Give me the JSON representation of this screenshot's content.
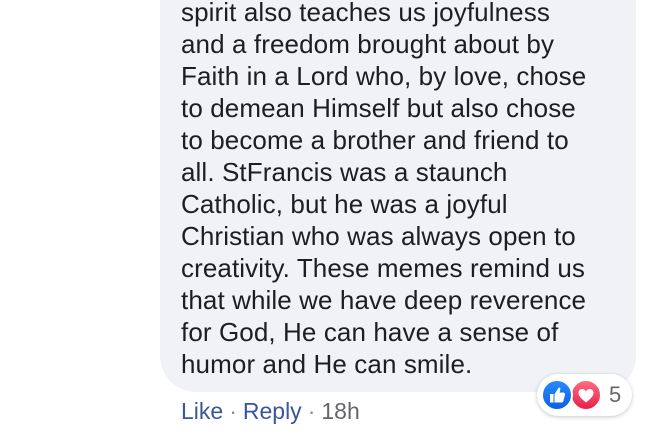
{
  "comment": {
    "lines": [
      "spirit also teaches us joyfulness",
      "and a freedom brought about by",
      "Faith in a Lord who, by love, chose",
      "to demean Himself but also chose",
      "to become a brother and friend to",
      "all. StFrancis was a staunch",
      "Catholic, but he was a joyful",
      "Christian who was always open to",
      "creativity. These memes remind us",
      "that while we have deep reverence",
      "for God, He can have a sense of",
      "humor and He can smile."
    ]
  },
  "actions": {
    "like_label": "Like",
    "reply_label": "Reply",
    "separator": "·",
    "timestamp": "18h"
  },
  "reactions": {
    "icons": [
      "like-icon",
      "love-icon"
    ],
    "count": "5",
    "colors": {
      "like": "#1877f2",
      "love": "#f33e58"
    }
  },
  "colors": {
    "bubble_background": "#f0f2f5",
    "text": "#1c1e21",
    "link": "#385898",
    "meta": "#65676b"
  }
}
